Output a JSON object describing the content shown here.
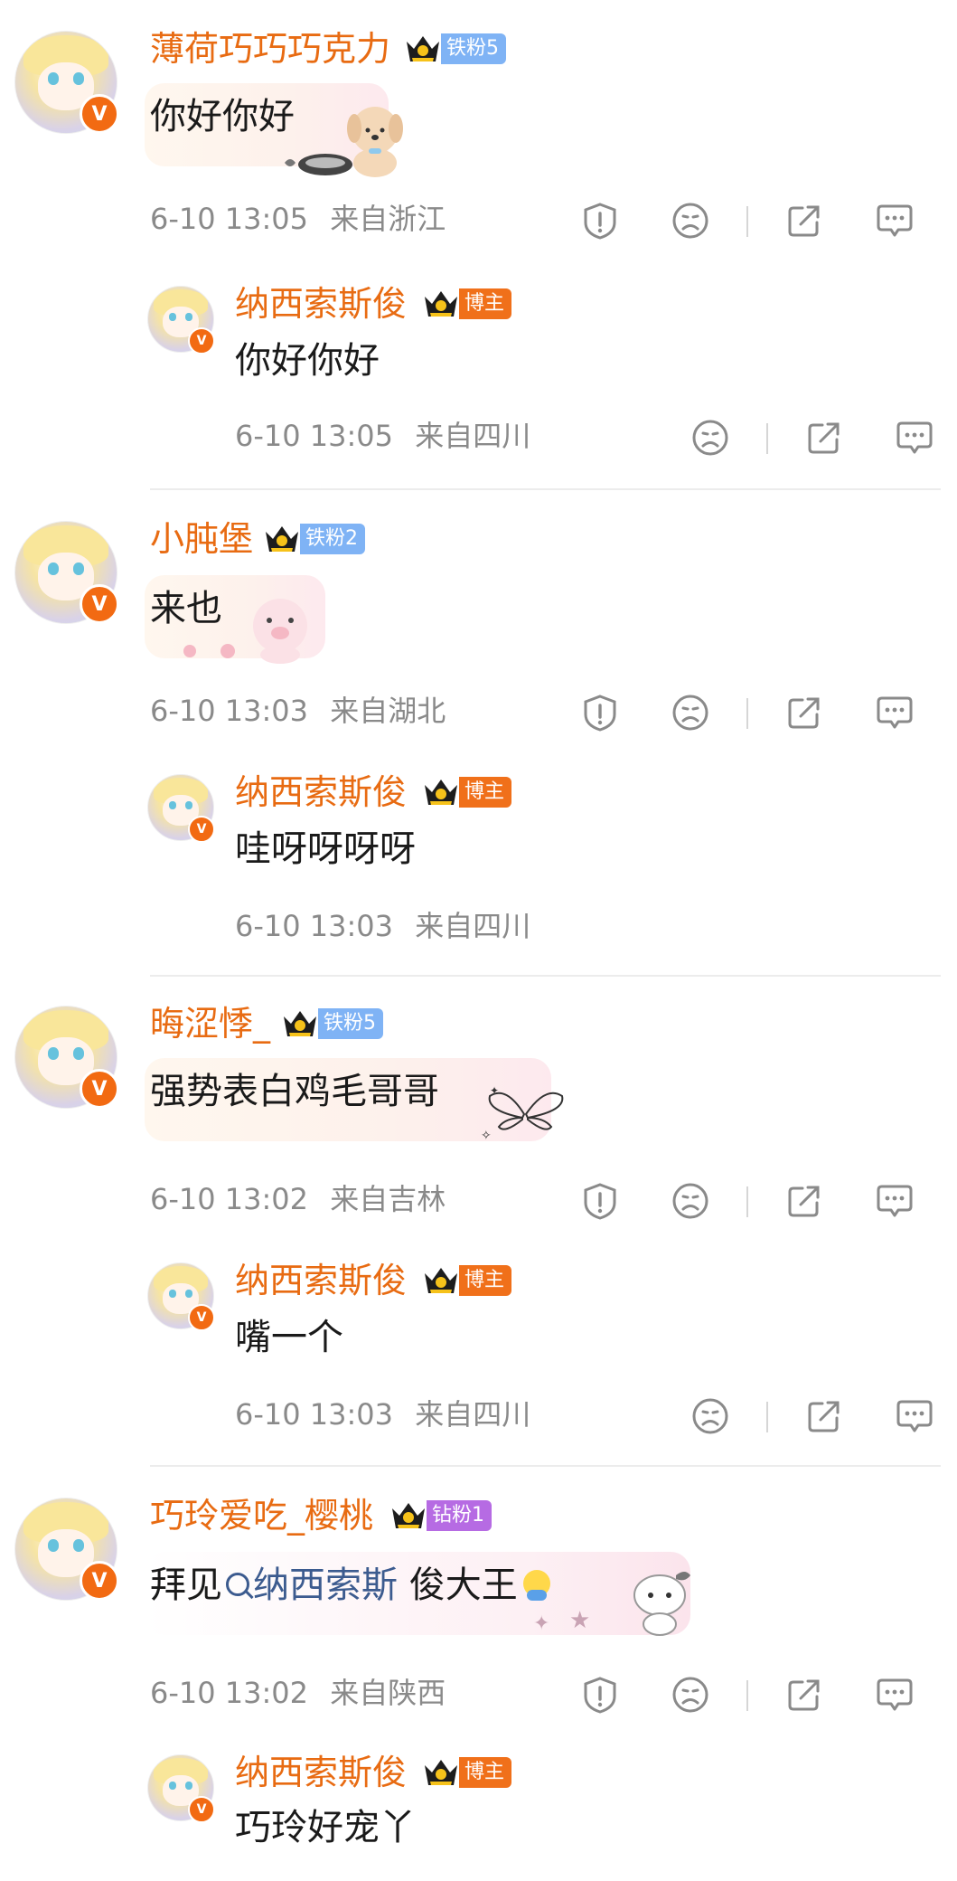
{
  "comments": [
    {
      "user": "薄荷巧巧巧克力",
      "fan_badge": "铁粉5",
      "text": "你好你好",
      "time": "6-10 13:05",
      "location": "来自浙江",
      "reply": {
        "user": "纳西索斯俊",
        "fan_badge": "博主",
        "text": "你好你好",
        "time": "6-10 13:05",
        "location": "来自四川"
      }
    },
    {
      "user": "小肫堡",
      "fan_badge": "铁粉2",
      "text": "来也",
      "time": "6-10 13:03",
      "location": "来自湖北",
      "reply": {
        "user": "纳西索斯俊",
        "fan_badge": "博主",
        "text": "哇呀呀呀呀",
        "time": "6-10 13:03",
        "location": "来自四川"
      }
    },
    {
      "user": "晦涩悸_",
      "fan_badge": "铁粉5",
      "text": "强势表白鸡毛哥哥",
      "time": "6-10 13:02",
      "location": "来自吉林",
      "reply": {
        "user": "纳西索斯俊",
        "fan_badge": "博主",
        "text": "嘴一个",
        "time": "6-10 13:03",
        "location": "来自四川"
      }
    },
    {
      "user": "巧玲爱吃_樱桃",
      "fan_badge": "钻粉1",
      "text_prefix": "拜见",
      "mention": "纳西索斯",
      "text_suffix": " 俊大王",
      "time": "6-10 13:02",
      "location": "来自陕西",
      "reply": {
        "user": "纳西索斯俊",
        "fan_badge": "博主",
        "text": "巧玲好宠丫"
      }
    }
  ],
  "icons": {
    "report": "report-icon",
    "dislike": "dislike-face-icon",
    "share": "share-icon",
    "reply": "comment-icon",
    "verified": "verified-v-badge",
    "crown": "crown-icon"
  },
  "colors": {
    "username": "#e86b12",
    "meta": "#8a8a8a",
    "icon": "#8a8a8a",
    "iron_fan": "#7fb3f5",
    "diamond_fan": "#b66be3",
    "host_badge": "#f0701a",
    "mention": "#3c5b8f"
  }
}
